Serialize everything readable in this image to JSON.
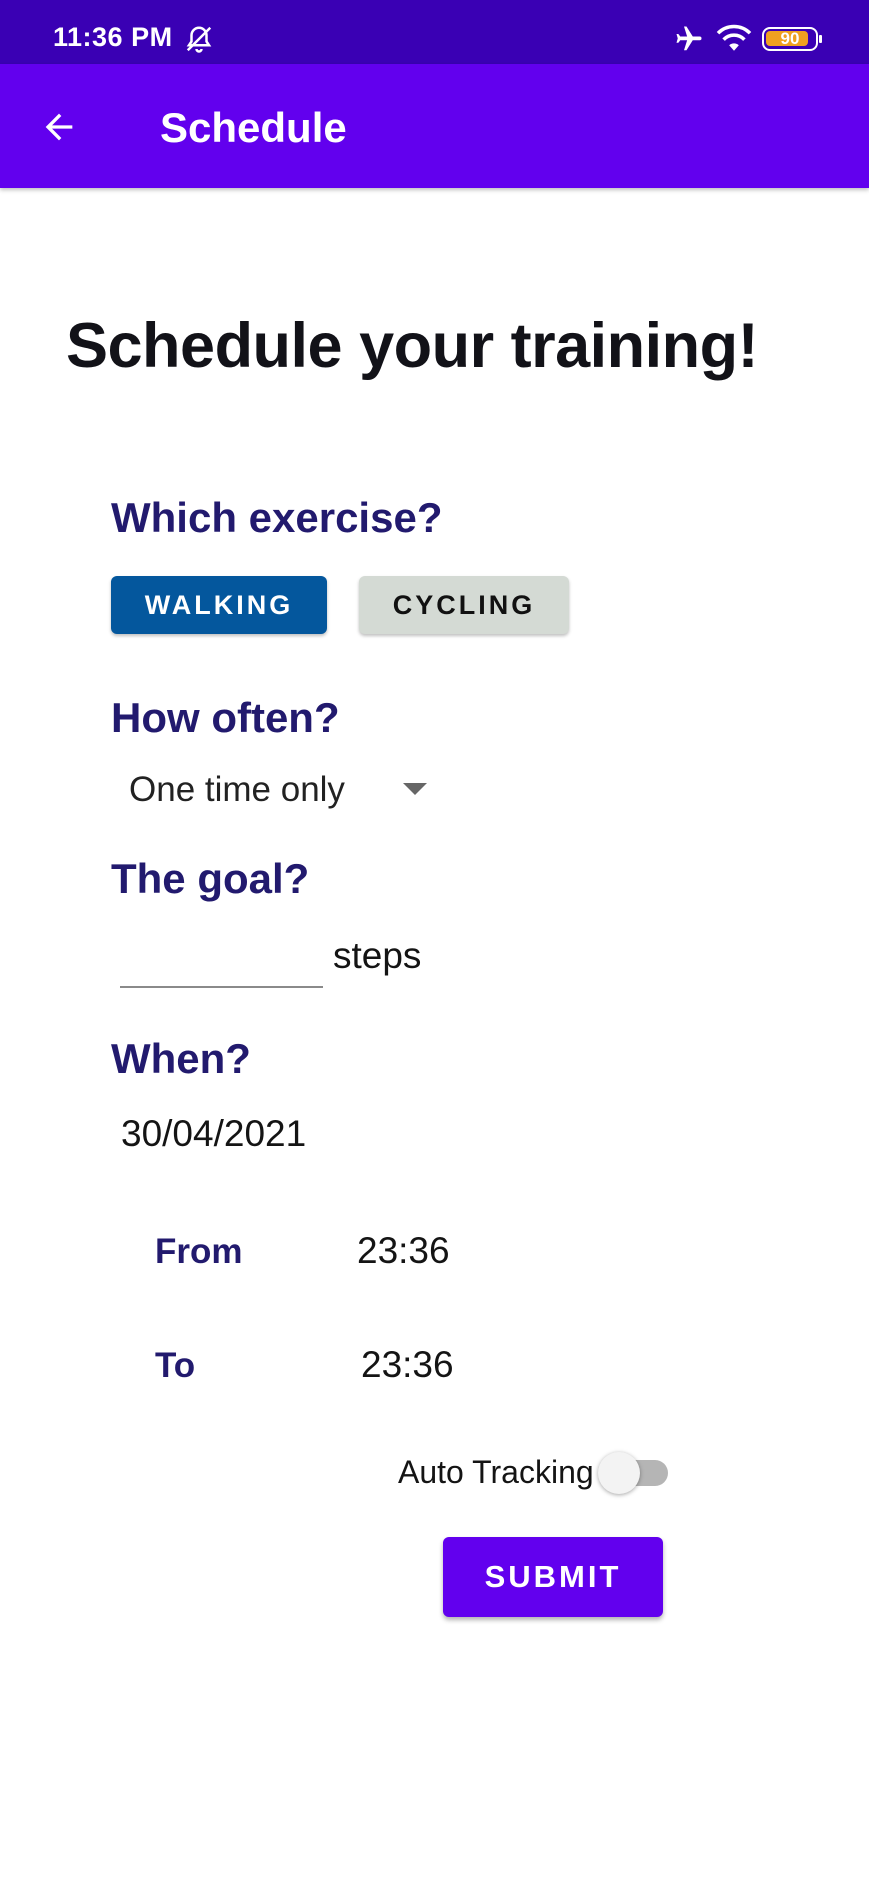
{
  "status_bar": {
    "time": "11:36 PM",
    "battery_level": "90",
    "battery_fraction": 0.9,
    "icons": [
      "alarm-off-icon",
      "airplane-icon",
      "wifi-icon",
      "battery-icon"
    ]
  },
  "app_bar": {
    "title": "Schedule",
    "back_icon": "arrow-back-icon",
    "background_color": "#6200ee"
  },
  "main": {
    "heading": "Schedule your training!",
    "exercise": {
      "label": "Which exercise?",
      "options": [
        {
          "label": "WALKING",
          "selected": true,
          "color": "#04579d"
        },
        {
          "label": "CYCLING",
          "selected": false,
          "color": "#d4dad4"
        }
      ]
    },
    "frequency": {
      "label": "How often?",
      "selected": "One time only"
    },
    "goal": {
      "label": "The goal?",
      "value": "",
      "unit": "steps"
    },
    "when": {
      "label": "When?",
      "date": "30/04/2021",
      "from_label": "From",
      "from_time": "23:36",
      "to_label": "To",
      "to_time": "23:36"
    },
    "auto_tracking": {
      "label": "Auto Tracking",
      "enabled": false
    },
    "submit_label": "SUBMIT"
  }
}
